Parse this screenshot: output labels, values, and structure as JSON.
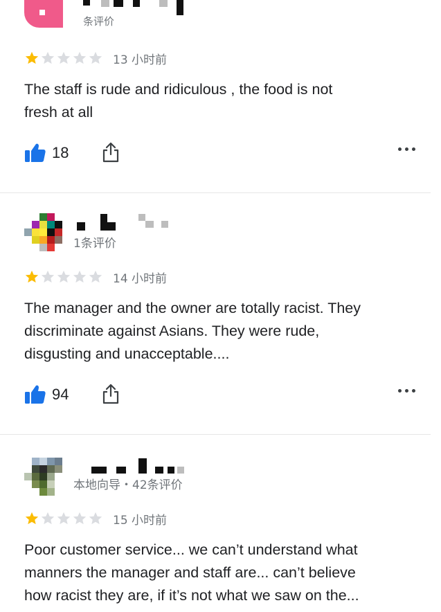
{
  "colors": {
    "star_filled": "#fbbc04",
    "star_empty": "#dadce0",
    "like_blue": "#1a73e8",
    "text": "#202124",
    "meta": "#70757a"
  },
  "reviews": [
    {
      "meta": "条评价",
      "rating": 1,
      "time": "13 小时前",
      "text_lines": [
        "The staff is rude and ridiculous , the food is not",
        "fresh at all"
      ],
      "likes": "18",
      "icons": [
        "thumbs-up-icon",
        "share-icon",
        "more-icon"
      ]
    },
    {
      "meta": "1条评价",
      "rating": 1,
      "time": "14 小时前",
      "text_lines": [
        "The manager and the owner are totally racist. They",
        "discriminate against Asians. They were rude,",
        "disgusting and unacceptable...."
      ],
      "likes": "94",
      "icons": [
        "thumbs-up-icon",
        "share-icon",
        "more-icon"
      ]
    },
    {
      "meta": "本地向导・42条评价",
      "rating": 1,
      "time": "15 小时前",
      "text_lines": [
        "Poor customer service... we can’t understand what",
        "manners the manager and staff are... can’t believe",
        "how racist they are, if it’s not what we saw on the..."
      ]
    }
  ]
}
